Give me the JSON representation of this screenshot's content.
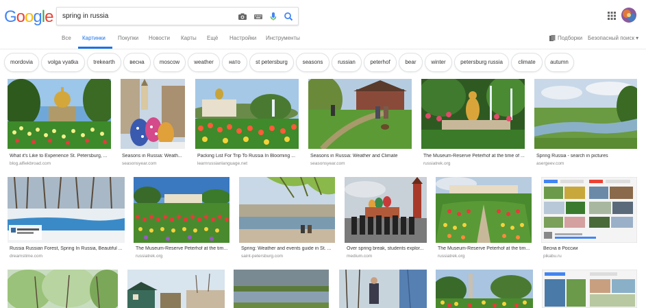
{
  "search": {
    "query": "spring in russia"
  },
  "tabs": [
    "Все",
    "Картинки",
    "Покупки",
    "Новости",
    "Карты",
    "Ещё",
    "Настройки",
    "Инструменты"
  ],
  "tools": {
    "collections": "Подборки",
    "safesearch": "Безопасный поиск ▾"
  },
  "chips": [
    "mordovia",
    "volga vyatka",
    "trekearth",
    "весна",
    "moscow",
    "weather",
    "нато",
    "st petersburg",
    "seasons",
    "russian",
    "peterhof",
    "bear",
    "winter",
    "petersburg russia",
    "climate",
    "autumn"
  ],
  "results": [
    {
      "caption": "What it's Like to Experience St. Petersburg, ...",
      "source": "blog.alfiekbroad.com"
    },
    {
      "caption": "Seasons in Russia: Weath...",
      "source": "seasonsyear.com"
    },
    {
      "caption": "Packing List For Trip To Russia In Blooming ...",
      "source": "learnrussianlanguage.net"
    },
    {
      "caption": "Seasons in Russia: Weather and Climate",
      "source": "seasonsyear.com"
    },
    {
      "caption": "The Museum-Reserve Peterhof at the time of ...",
      "source": "russiatrek.org"
    },
    {
      "caption": "Spring Russia - search in pictures",
      "source": "asergeev.com"
    },
    {
      "caption": "Russia Russian Forest, Spring In Russia, Beautiful ...",
      "source": "dreamstime.com"
    },
    {
      "caption": "The Museum-Reserve Peterhof at the tim...",
      "source": "russiatrek.org"
    },
    {
      "caption": "Spring: Weather and events guide in St. ...",
      "source": "saint-petersburg.com"
    },
    {
      "caption": "Over spring break, students explor...",
      "source": "medium.com"
    },
    {
      "caption": "The Museum-Reserve Peterhof at the tim...",
      "source": "russiatrek.org"
    },
    {
      "caption": "Весна в России",
      "source": "pikabu.ru"
    }
  ],
  "colors": {
    "accent": "#1a73e8",
    "google_blue": "#4285f4",
    "google_red": "#ea4335",
    "google_yellow": "#fbbc05",
    "google_green": "#34a853"
  }
}
